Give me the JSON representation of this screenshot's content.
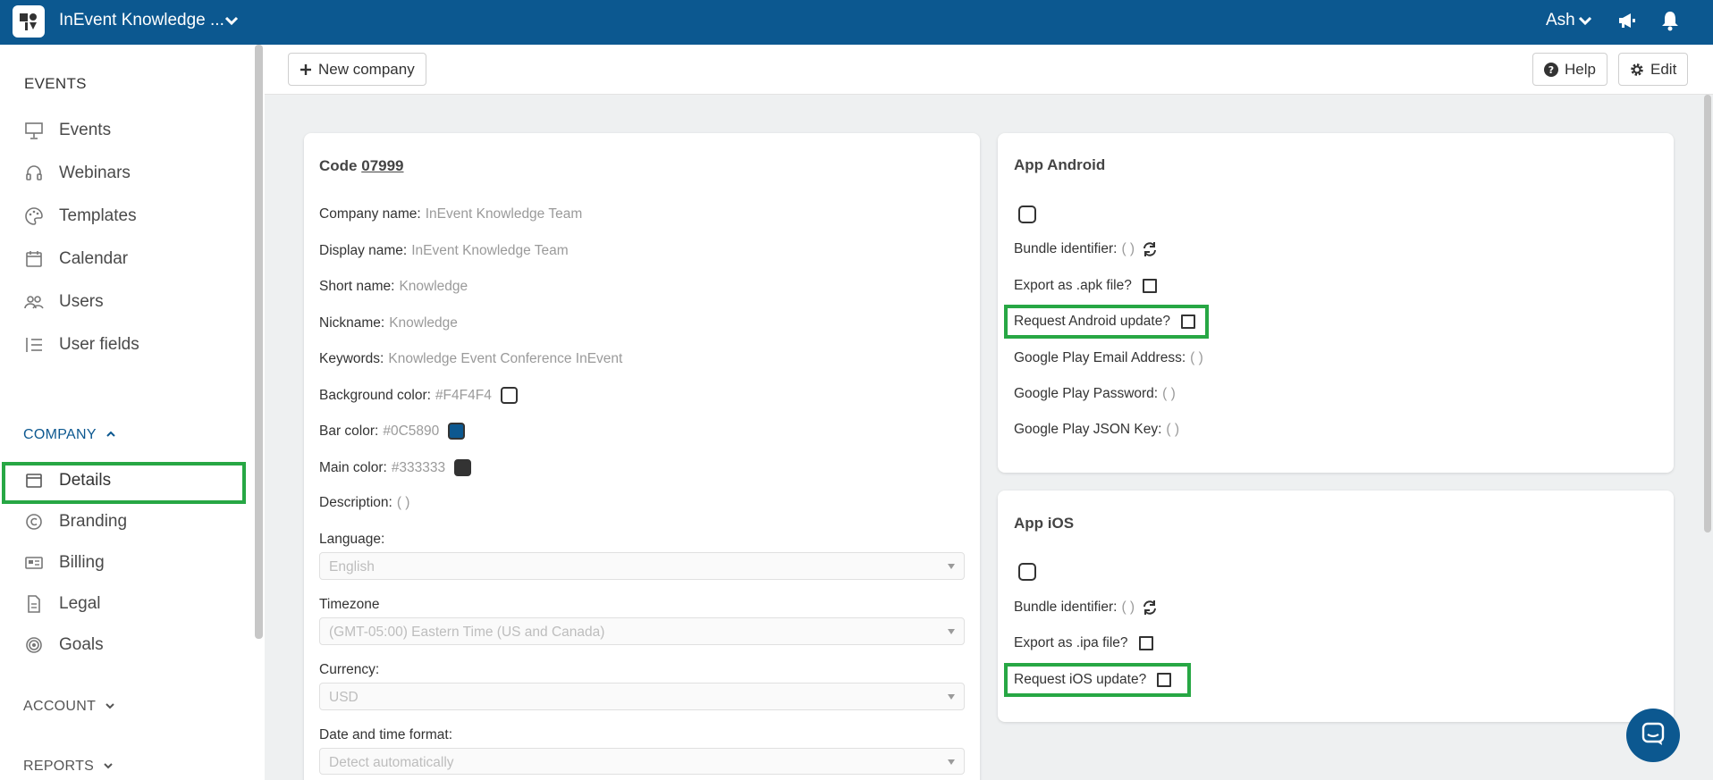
{
  "topbar": {
    "app_title": "InEvent Knowledge ...",
    "user_name": "Ash",
    "logo_icon": "inevent-logo",
    "bg_color": "#0C5890"
  },
  "sidebar": {
    "events_section": "EVENTS",
    "events_items": [
      {
        "label": "Events",
        "icon": "presentation-icon"
      },
      {
        "label": "Webinars",
        "icon": "headset-icon"
      },
      {
        "label": "Templates",
        "icon": "palette-icon"
      },
      {
        "label": "Calendar",
        "icon": "calendar-icon"
      },
      {
        "label": "Users",
        "icon": "users-icon"
      },
      {
        "label": "User fields",
        "icon": "list-icon"
      }
    ],
    "company_section": "COMPANY",
    "company_items": [
      {
        "label": "Details",
        "icon": "window-icon",
        "active": true
      },
      {
        "label": "Branding",
        "icon": "copyright-icon"
      },
      {
        "label": "Billing",
        "icon": "id-card-icon"
      },
      {
        "label": "Legal",
        "icon": "document-icon"
      },
      {
        "label": "Goals",
        "icon": "target-icon"
      }
    ],
    "account_section": "ACCOUNT",
    "reports_section": "REPORTS"
  },
  "toolbar": {
    "new_company_label": "New company",
    "help_label": "Help",
    "edit_label": "Edit"
  },
  "company_card": {
    "code_label": "Code",
    "code_value": "07999",
    "fields": [
      {
        "label": "Company name:",
        "value": "InEvent Knowledge Team"
      },
      {
        "label": "Display name:",
        "value": "InEvent Knowledge Team"
      },
      {
        "label": "Short name:",
        "value": "Knowledge"
      },
      {
        "label": "Nickname:",
        "value": "Knowledge"
      },
      {
        "label": "Keywords:",
        "value": "Knowledge Event Conference InEvent"
      },
      {
        "label": "Background color:",
        "value": "#F4F4F4",
        "swatch": "#FFFFFF"
      },
      {
        "label": "Bar color:",
        "value": "#0C5890",
        "swatch": "#0C5890"
      },
      {
        "label": "Main color:",
        "value": "#333333",
        "swatch": "#333333"
      },
      {
        "label": "Description:",
        "value": "( )"
      }
    ],
    "language": {
      "label": "Language:",
      "value": "English"
    },
    "timezone": {
      "label": "Timezone",
      "value": "(GMT-05:00) Eastern Time (US and Canada)"
    },
    "currency": {
      "label": "Currency:",
      "value": "USD"
    },
    "datetime": {
      "label": "Date and time format:",
      "value": "Detect automatically"
    }
  },
  "android_card": {
    "title": "App Android",
    "bundle_label": "Bundle identifier:",
    "bundle_value": "( )",
    "export_label": "Export as .apk file?",
    "request_label": "Request Android update?",
    "gp_email_label": "Google Play Email Address:",
    "gp_email_value": "( )",
    "gp_password_label": "Google Play Password:",
    "gp_password_value": "( )",
    "gp_json_label": "Google Play JSON Key:",
    "gp_json_value": "( )"
  },
  "ios_card": {
    "title": "App iOS",
    "bundle_label": "Bundle identifier:",
    "bundle_value": "( )",
    "export_label": "Export as .ipa file?",
    "request_label": "Request iOS update?"
  },
  "colors": {
    "accent": "#0C5890",
    "highlight": "#27A744"
  }
}
